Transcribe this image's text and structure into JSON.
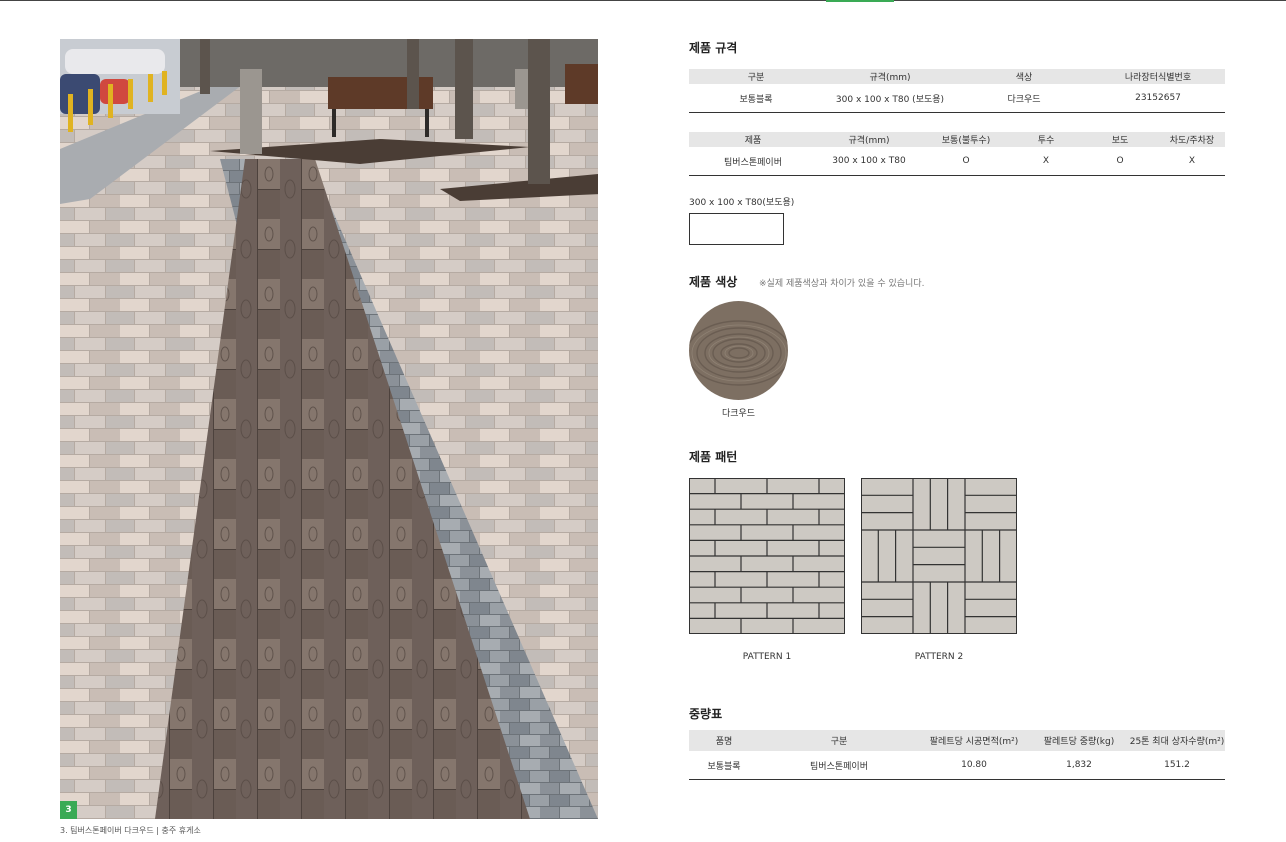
{
  "page": {
    "photo_badge": "3",
    "caption": "3. 팀버스톤페이버 다크우드 | 충주 휴게소"
  },
  "spec_section": {
    "title": "제품 규격",
    "table1": {
      "headers": [
        "구분",
        "규격(mm)",
        "색상",
        "나라장터식별번호"
      ],
      "rows": [
        [
          "보통블록",
          "300 x 100 x T80 (보도용)",
          "다크우드",
          "23152657"
        ]
      ]
    },
    "table2": {
      "headers": [
        "제품",
        "규격(mm)",
        "보통(불투수)",
        "투수",
        "보도",
        "차도/주차장"
      ],
      "rows": [
        [
          "팀버스톤페이버",
          "300 x 100 x T80",
          "O",
          "X",
          "O",
          "X"
        ]
      ]
    },
    "size_label": "300 x 100 x T80(보도용)"
  },
  "color_section": {
    "title": "제품 색상",
    "note": "※실제 제품색상과 차이가 있을 수 있습니다.",
    "swatch_label": "다크우드",
    "swatch_color": "#7d6f62"
  },
  "pattern_section": {
    "title": "제품 패턴",
    "patterns": [
      {
        "label": "PATTERN 1"
      },
      {
        "label": "PATTERN 2"
      }
    ]
  },
  "weight_section": {
    "title": "중량표",
    "headers": [
      "품명",
      "구분",
      "팔레트당 시공면적(m²)",
      "팔레트당 중량(kg)",
      "25톤 최대 상자수량(m²)"
    ],
    "rows": [
      [
        "보통블록",
        "팀버스톤페이버",
        "10.80",
        "1,832",
        "151.2"
      ]
    ]
  },
  "colors": {
    "accent_green": "#3aaa55",
    "header_gray": "#e6e6e6"
  }
}
